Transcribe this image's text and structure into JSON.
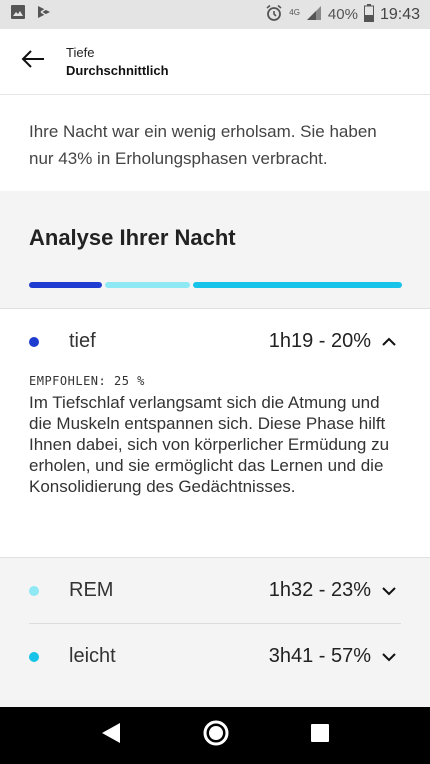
{
  "status_bar": {
    "network": "4G",
    "battery": "40%",
    "time": "19:43"
  },
  "header": {
    "subtitle": "Tiefe",
    "title": "Durchschnittlich"
  },
  "summary": {
    "text": "Ihre Nacht war ein wenig erholsam. Sie haben nur 43% in Erholungsphasen verbracht."
  },
  "analysis": {
    "title": "Analyse Ihrer Nacht",
    "colors": {
      "tief": "#1e3ccf",
      "rem": "#8ee9f5",
      "leicht": "#17c3e8"
    },
    "phases": [
      {
        "label": "tief",
        "value": "1h19 - 20%",
        "share": 0.2,
        "expanded": true,
        "recommended": "EMPFOHLEN: 25 %",
        "description": "Im Tiefschlaf verlangsamt sich die Atmung und die Muskeln entspannen sich. Diese Phase hilft Ihnen dabei, sich von körperlicher Ermüdung zu erholen, und sie ermöglicht das Lernen und die Konsolidierung des Gedächtnisses."
      },
      {
        "label": "REM",
        "value": "1h32 - 23%",
        "share": 0.23,
        "expanded": false
      },
      {
        "label": "leicht",
        "value": "3h41 - 57%",
        "share": 0.57,
        "expanded": false
      }
    ]
  }
}
